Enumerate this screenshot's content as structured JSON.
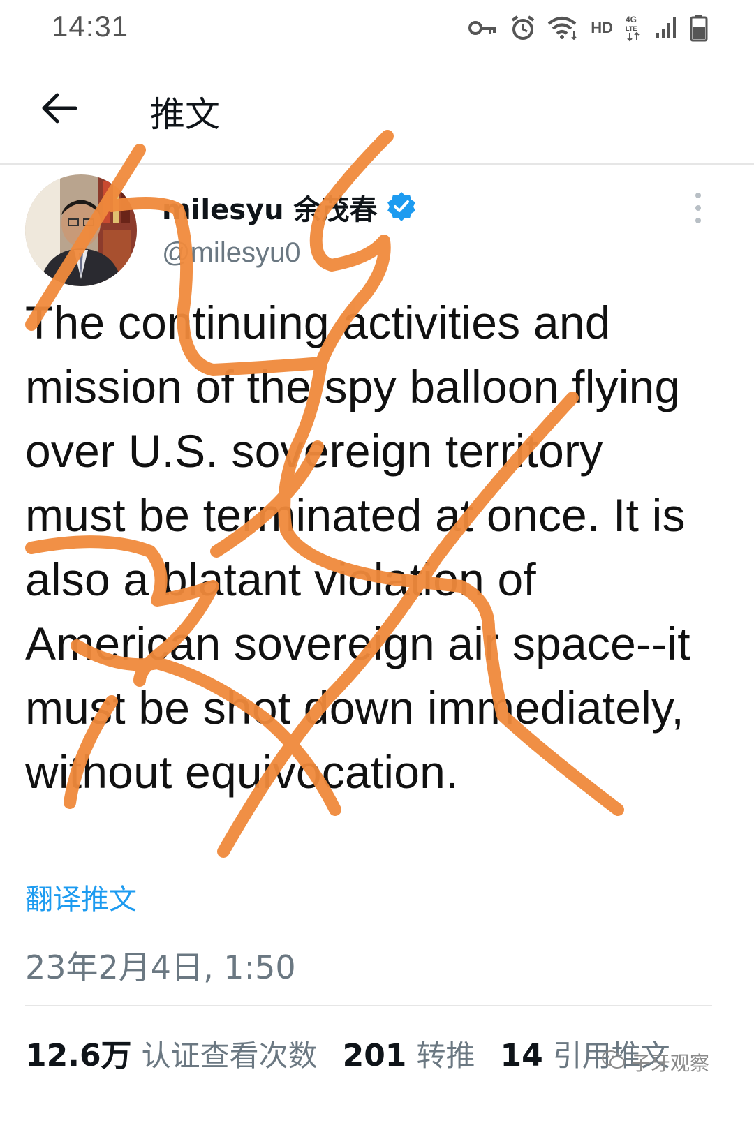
{
  "status_bar": {
    "time": "14:31",
    "icons": [
      "key-icon",
      "alarm-icon",
      "wifi-icon",
      "hd-icon",
      "4g-lte-icon",
      "signal-icon",
      "battery-icon"
    ],
    "hd_label": "HD",
    "lte_label": "4G"
  },
  "header": {
    "title": "推文",
    "back_icon": "arrow-left-icon"
  },
  "tweet": {
    "author_name": "milesyu 余茂春",
    "verified_icon": "verified-badge-icon",
    "handle": "@milesyu0",
    "text": "The continuing activities and mission of the spy balloon flying over U.S. sovereign territory must be terminated at once. It is also a blatant violation of American sovereign air space--it must be shot down immediately, without equivocation.",
    "translate_label": "翻译推文",
    "date": "23年2月4日, 1:50"
  },
  "stats": [
    {
      "number": "12.6万",
      "label": "认证查看次数"
    },
    {
      "number": "201",
      "label": "转推"
    },
    {
      "number": "14",
      "label": "引用推文"
    }
  ],
  "watermark": {
    "text": "子牙观察",
    "icon": "wechat-icon"
  },
  "colors": {
    "accent": "#1d9bf0",
    "scribble": "#f08a3c",
    "text": "#0f1419",
    "muted": "#6b7882"
  }
}
